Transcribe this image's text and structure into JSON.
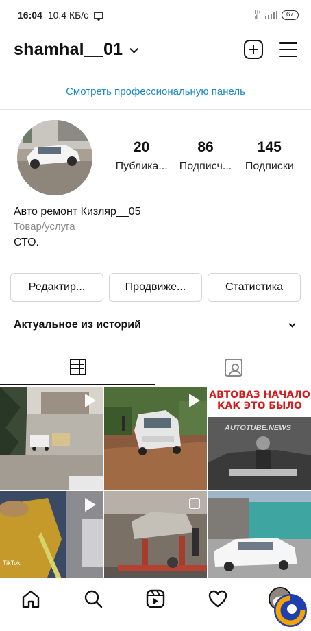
{
  "status_bar": {
    "time": "16:04",
    "speed": "10,4 КБ/с",
    "network_top": "Н+",
    "network_bottom": "ıll",
    "battery": "67"
  },
  "header": {
    "username": "shamhal__01"
  },
  "pro_panel": {
    "label": "Смотреть профессиональную панель"
  },
  "stats": [
    {
      "value": "20",
      "label": "Публика..."
    },
    {
      "value": "86",
      "label": "Подписч..."
    },
    {
      "value": "145",
      "label": "Подписки"
    }
  ],
  "bio": {
    "name": "Авто ремонт Кизляр__05",
    "category": "Товар/услуга",
    "text": "СТО."
  },
  "buttons": {
    "edit": "Редактир...",
    "promote": "Продвиже...",
    "statistics": "Статистика"
  },
  "highlights": {
    "title": "Актуальное из историй"
  },
  "posts": [
    {
      "type": "reel"
    },
    {
      "type": "reel"
    },
    {
      "type": "image",
      "caption": "АВТОВАЗ НАЧАЛО КАК ЭТО БЫЛО",
      "watermark": "AUTOTUBE.NEWS"
    },
    {
      "type": "reel",
      "overlay": "TikTok"
    },
    {
      "type": "multi"
    },
    {
      "type": "image"
    }
  ],
  "colors": {
    "accent_link": "#1d88c8",
    "border": "#d4d4d4",
    "text": "#111111",
    "muted": "#8a8a8a"
  },
  "icons": {
    "add": "plus-square-icon",
    "menu": "hamburger-menu-icon",
    "grid": "grid-icon",
    "tagged": "tagged-person-icon",
    "home": "home-icon",
    "search": "search-icon",
    "reels": "reels-icon",
    "activity": "heart-icon"
  }
}
